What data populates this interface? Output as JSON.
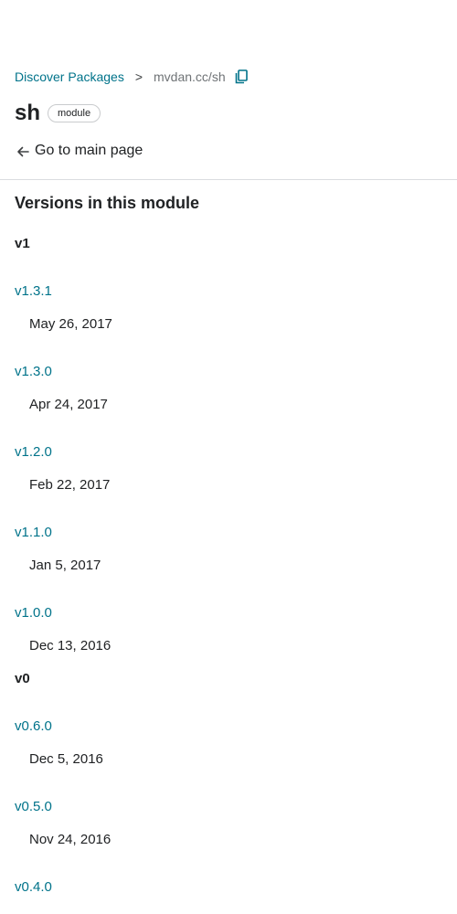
{
  "breadcrumb": {
    "root_label": "Discover Packages",
    "separator": ">",
    "current": "mvdan.cc/sh"
  },
  "header": {
    "title": "sh",
    "badge": "module",
    "back_link": "Go to main page"
  },
  "versions": {
    "section_title": "Versions in this module",
    "groups": [
      {
        "major": "v1",
        "items": [
          {
            "version": "v1.3.1",
            "date": "May 26, 2017"
          },
          {
            "version": "v1.3.0",
            "date": "Apr 24, 2017"
          },
          {
            "version": "v1.2.0",
            "date": "Feb 22, 2017"
          },
          {
            "version": "v1.1.0",
            "date": "Jan 5, 2017"
          },
          {
            "version": "v1.0.0",
            "date": "Dec 13, 2016"
          }
        ]
      },
      {
        "major": "v0",
        "items": [
          {
            "version": "v0.6.0",
            "date": "Dec 5, 2016"
          },
          {
            "version": "v0.5.0",
            "date": "Nov 24, 2016"
          },
          {
            "version": "v0.4.0",
            "date": ""
          }
        ]
      }
    ]
  },
  "colors": {
    "link": "#00738a",
    "text": "#202224",
    "muted": "#6f7376",
    "divider": "#dadce0"
  }
}
